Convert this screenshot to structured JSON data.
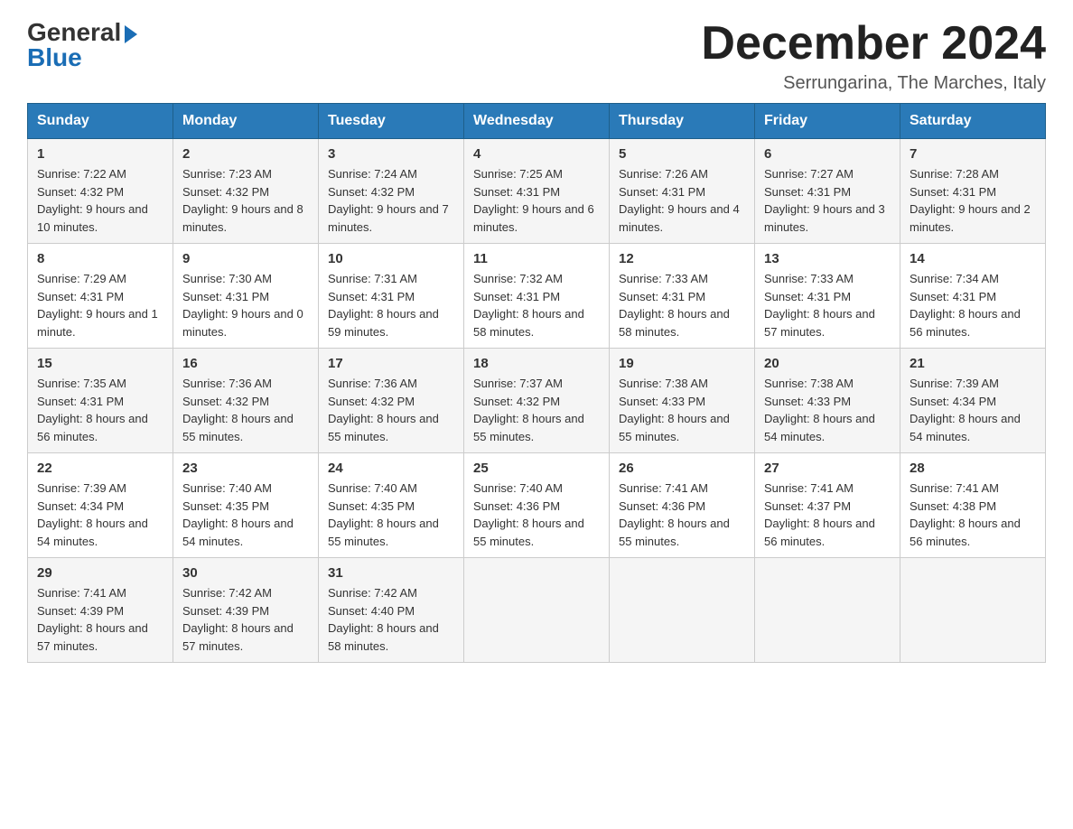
{
  "logo": {
    "general": "General",
    "blue": "Blue"
  },
  "title": "December 2024",
  "subtitle": "Serrungarina, The Marches, Italy",
  "days_of_week": [
    "Sunday",
    "Monday",
    "Tuesday",
    "Wednesday",
    "Thursday",
    "Friday",
    "Saturday"
  ],
  "weeks": [
    [
      {
        "day": "1",
        "sunrise": "7:22 AM",
        "sunset": "4:32 PM",
        "daylight": "9 hours and 10 minutes."
      },
      {
        "day": "2",
        "sunrise": "7:23 AM",
        "sunset": "4:32 PM",
        "daylight": "9 hours and 8 minutes."
      },
      {
        "day": "3",
        "sunrise": "7:24 AM",
        "sunset": "4:32 PM",
        "daylight": "9 hours and 7 minutes."
      },
      {
        "day": "4",
        "sunrise": "7:25 AM",
        "sunset": "4:31 PM",
        "daylight": "9 hours and 6 minutes."
      },
      {
        "day": "5",
        "sunrise": "7:26 AM",
        "sunset": "4:31 PM",
        "daylight": "9 hours and 4 minutes."
      },
      {
        "day": "6",
        "sunrise": "7:27 AM",
        "sunset": "4:31 PM",
        "daylight": "9 hours and 3 minutes."
      },
      {
        "day": "7",
        "sunrise": "7:28 AM",
        "sunset": "4:31 PM",
        "daylight": "9 hours and 2 minutes."
      }
    ],
    [
      {
        "day": "8",
        "sunrise": "7:29 AM",
        "sunset": "4:31 PM",
        "daylight": "9 hours and 1 minute."
      },
      {
        "day": "9",
        "sunrise": "7:30 AM",
        "sunset": "4:31 PM",
        "daylight": "9 hours and 0 minutes."
      },
      {
        "day": "10",
        "sunrise": "7:31 AM",
        "sunset": "4:31 PM",
        "daylight": "8 hours and 59 minutes."
      },
      {
        "day": "11",
        "sunrise": "7:32 AM",
        "sunset": "4:31 PM",
        "daylight": "8 hours and 58 minutes."
      },
      {
        "day": "12",
        "sunrise": "7:33 AM",
        "sunset": "4:31 PM",
        "daylight": "8 hours and 58 minutes."
      },
      {
        "day": "13",
        "sunrise": "7:33 AM",
        "sunset": "4:31 PM",
        "daylight": "8 hours and 57 minutes."
      },
      {
        "day": "14",
        "sunrise": "7:34 AM",
        "sunset": "4:31 PM",
        "daylight": "8 hours and 56 minutes."
      }
    ],
    [
      {
        "day": "15",
        "sunrise": "7:35 AM",
        "sunset": "4:31 PM",
        "daylight": "8 hours and 56 minutes."
      },
      {
        "day": "16",
        "sunrise": "7:36 AM",
        "sunset": "4:32 PM",
        "daylight": "8 hours and 55 minutes."
      },
      {
        "day": "17",
        "sunrise": "7:36 AM",
        "sunset": "4:32 PM",
        "daylight": "8 hours and 55 minutes."
      },
      {
        "day": "18",
        "sunrise": "7:37 AM",
        "sunset": "4:32 PM",
        "daylight": "8 hours and 55 minutes."
      },
      {
        "day": "19",
        "sunrise": "7:38 AM",
        "sunset": "4:33 PM",
        "daylight": "8 hours and 55 minutes."
      },
      {
        "day": "20",
        "sunrise": "7:38 AM",
        "sunset": "4:33 PM",
        "daylight": "8 hours and 54 minutes."
      },
      {
        "day": "21",
        "sunrise": "7:39 AM",
        "sunset": "4:34 PM",
        "daylight": "8 hours and 54 minutes."
      }
    ],
    [
      {
        "day": "22",
        "sunrise": "7:39 AM",
        "sunset": "4:34 PM",
        "daylight": "8 hours and 54 minutes."
      },
      {
        "day": "23",
        "sunrise": "7:40 AM",
        "sunset": "4:35 PM",
        "daylight": "8 hours and 54 minutes."
      },
      {
        "day": "24",
        "sunrise": "7:40 AM",
        "sunset": "4:35 PM",
        "daylight": "8 hours and 55 minutes."
      },
      {
        "day": "25",
        "sunrise": "7:40 AM",
        "sunset": "4:36 PM",
        "daylight": "8 hours and 55 minutes."
      },
      {
        "day": "26",
        "sunrise": "7:41 AM",
        "sunset": "4:36 PM",
        "daylight": "8 hours and 55 minutes."
      },
      {
        "day": "27",
        "sunrise": "7:41 AM",
        "sunset": "4:37 PM",
        "daylight": "8 hours and 56 minutes."
      },
      {
        "day": "28",
        "sunrise": "7:41 AM",
        "sunset": "4:38 PM",
        "daylight": "8 hours and 56 minutes."
      }
    ],
    [
      {
        "day": "29",
        "sunrise": "7:41 AM",
        "sunset": "4:39 PM",
        "daylight": "8 hours and 57 minutes."
      },
      {
        "day": "30",
        "sunrise": "7:42 AM",
        "sunset": "4:39 PM",
        "daylight": "8 hours and 57 minutes."
      },
      {
        "day": "31",
        "sunrise": "7:42 AM",
        "sunset": "4:40 PM",
        "daylight": "8 hours and 58 minutes."
      },
      null,
      null,
      null,
      null
    ]
  ]
}
